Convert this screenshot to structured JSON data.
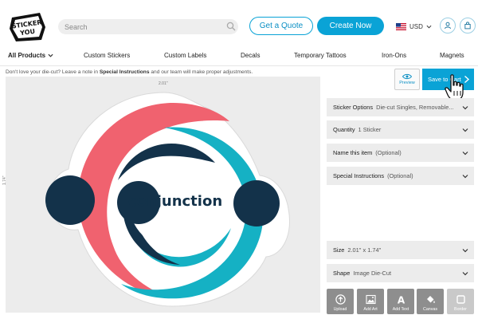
{
  "header": {
    "logo_line1": "STICKER",
    "logo_line2": "YOU",
    "search_placeholder": "Search",
    "quote_label": "Get a Quote",
    "create_label": "Create Now",
    "currency": "USD"
  },
  "nav": [
    "All Products",
    "Custom Stickers",
    "Custom Labels",
    "Decals",
    "Temporary Tattoos",
    "Iron-Ons",
    "Magnets"
  ],
  "canvas": {
    "notice_pre": "Don't love your die-cut? Leave a note in",
    "notice_bold": "Special Instructions",
    "notice_post": "and our team will make proper adjustments.",
    "width_label": "2.01\"",
    "height_label": "1.74\"",
    "sticker_text": "conjunction"
  },
  "actions": {
    "preview_label": "Preview",
    "save_label": "Save to Cart"
  },
  "options": [
    {
      "key": "Sticker Options",
      "value": "Die-cut Singles, Removable..."
    },
    {
      "key": "Quantity",
      "value": "1 Sticker"
    },
    {
      "key": "Name this item",
      "value": "(Optional)"
    },
    {
      "key": "Special Instructions",
      "value": "(Optional)"
    },
    {
      "key": "Size",
      "value": "2.01\" x 1.74\""
    },
    {
      "key": "Shape",
      "value": "Image Die-Cut"
    }
  ],
  "tools": [
    "Upload",
    "Add Art",
    "Add Text",
    "Canvas",
    "Border"
  ],
  "colors": {
    "accent": "#0aa3d6",
    "sticker_red": "#f0626f",
    "sticker_teal": "#15b1c4",
    "sticker_navy": "#13324a"
  }
}
